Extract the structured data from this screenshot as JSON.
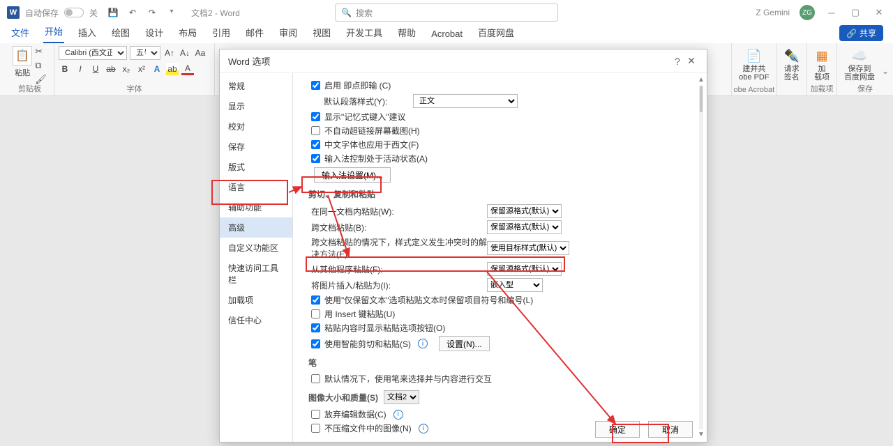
{
  "title": {
    "autosave": "自动保存",
    "autosave_state": "关",
    "doc": "文档2 - Word",
    "search_placeholder": "搜索",
    "username": "Z Gemini",
    "avatar_initials": "ZG"
  },
  "tabs": {
    "file": "文件",
    "home": "开始",
    "insert": "插入",
    "draw": "绘图",
    "design": "设计",
    "layout": "布局",
    "references": "引用",
    "mailings": "邮件",
    "review": "审阅",
    "view": "视图",
    "developer": "开发工具",
    "help": "帮助",
    "acrobat": "Acrobat",
    "baidu": "百度网盘",
    "share": "共享"
  },
  "ribbon": {
    "paste": "粘贴",
    "clipboard": "剪贴板",
    "font_name": "Calibri (西文正文)",
    "font_size": "五号",
    "font_group": "字体",
    "r_createpdf1": "建并共",
    "r_createpdf2": "obe PDF",
    "r_sign1": "请求",
    "r_sign2": "签名",
    "r_addin1": "加",
    "r_addin2": "载项",
    "r_save1": "保存到",
    "r_save2": "百度网盘",
    "grp_acrobat": "obe Acrobat",
    "grp_addin": "加载项",
    "grp_save": "保存"
  },
  "dialog": {
    "title": "Word 选项",
    "nav": {
      "general": "常规",
      "display": "显示",
      "proofing": "校对",
      "save": "保存",
      "typography": "版式",
      "language": "语言",
      "accessibility": "辅助功能",
      "advanced": "高级",
      "customize_ribbon": "自定义功能区",
      "quick_access": "快速访问工具栏",
      "addins": "加载项",
      "trust": "信任中心"
    },
    "opts": {
      "enable_drop": "启用 即点即输 (C)",
      "default_para_label": "默认段落样式(Y):",
      "default_para_value": "正文",
      "show_autosuggest": "显示\"记忆式键入\"建议",
      "no_autohyperlink": "不自动超链接屏幕截图(H)",
      "cjk_westernfont": "中文字体也应用于西文(F)",
      "ime_active": "输入法控制处于活动状态(A)",
      "ime_settings_btn": "输入法设置(M)...",
      "section_paste": "剪切、复制和粘贴",
      "paste_samedoc_label": "在同一文档内粘贴(W):",
      "paste_samedoc_value": "保留源格式(默认)",
      "paste_crossdoc_label": "跨文档粘贴(B):",
      "paste_crossdoc_value": "保留源格式(默认)",
      "paste_crossdoc_conflict_label": "跨文档粘贴的情况下，样式定义发生冲突时的解决方法(E):",
      "paste_crossdoc_conflict_value": "使用目标样式(默认)",
      "paste_otherapp_label": "从其他程序粘贴(F):",
      "paste_otherapp_value": "保留源格式(默认)",
      "paste_image_label": "将图片插入/粘贴为(I):",
      "paste_image_value": "嵌入型",
      "keep_bullets": "使用\"仅保留文本\"选项粘贴文本时保留项目符号和编号(L)",
      "use_insertkey": "用 Insert 键粘贴(U)",
      "show_paste_btn": "粘贴内容时显示粘贴选项按钮(O)",
      "smart_cut": "使用智能剪切和粘贴(S)",
      "smart_settings_btn": "设置(N)...",
      "section_pen": "笔",
      "pen_default": "默认情况下，使用笔来选择并与内容进行交互",
      "section_image": "图像大小和质量(S)",
      "image_target": "文档2",
      "discard_edit": "放弃编辑数据(C)",
      "no_compress": "不压缩文件中的图像(N)"
    },
    "ok": "确定",
    "cancel": "取消"
  }
}
